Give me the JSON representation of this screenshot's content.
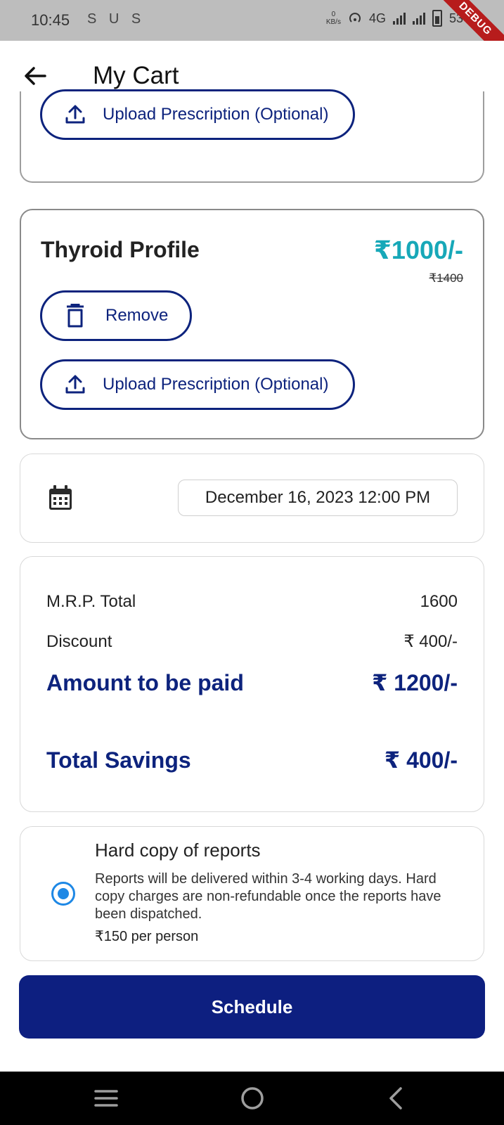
{
  "status_bar": {
    "time": "10:45",
    "notification_icons": "S U S",
    "net_speed_value": "0",
    "net_speed_unit": "KB/s",
    "network": "4G",
    "battery": "53",
    "debug_banner": "DEBUG"
  },
  "app_bar": {
    "title": "My Cart"
  },
  "partial_item": {
    "upload_label": "Upload Prescription (Optional)"
  },
  "cart_item": {
    "name": "Thyroid Profile",
    "price": "₹1000/-",
    "mrp": "₹1400",
    "remove_label": "Remove",
    "upload_label": "Upload Prescription (Optional)"
  },
  "schedule_date": {
    "value": "December 16, 2023 12:00 PM"
  },
  "summary": {
    "mrp_label": "M.R.P. Total",
    "mrp_value": "1600",
    "discount_label": "Discount",
    "discount_value": "₹ 400/-",
    "amount_label": "Amount to be paid",
    "amount_value": "₹ 1200/-",
    "savings_label": "Total Savings",
    "savings_value": "₹ 400/-"
  },
  "hard_copy": {
    "title": "Hard copy of reports",
    "description": "Reports will be delivered within 3-4 working days. Hard copy charges are non-refundable once the reports have been dispatched.",
    "price": "₹150 per person",
    "selected": true
  },
  "schedule_button": {
    "label": "Schedule"
  },
  "colors": {
    "primary": "#0d1f80",
    "price_accent": "#17a8b8",
    "radio": "#1e88e5"
  }
}
